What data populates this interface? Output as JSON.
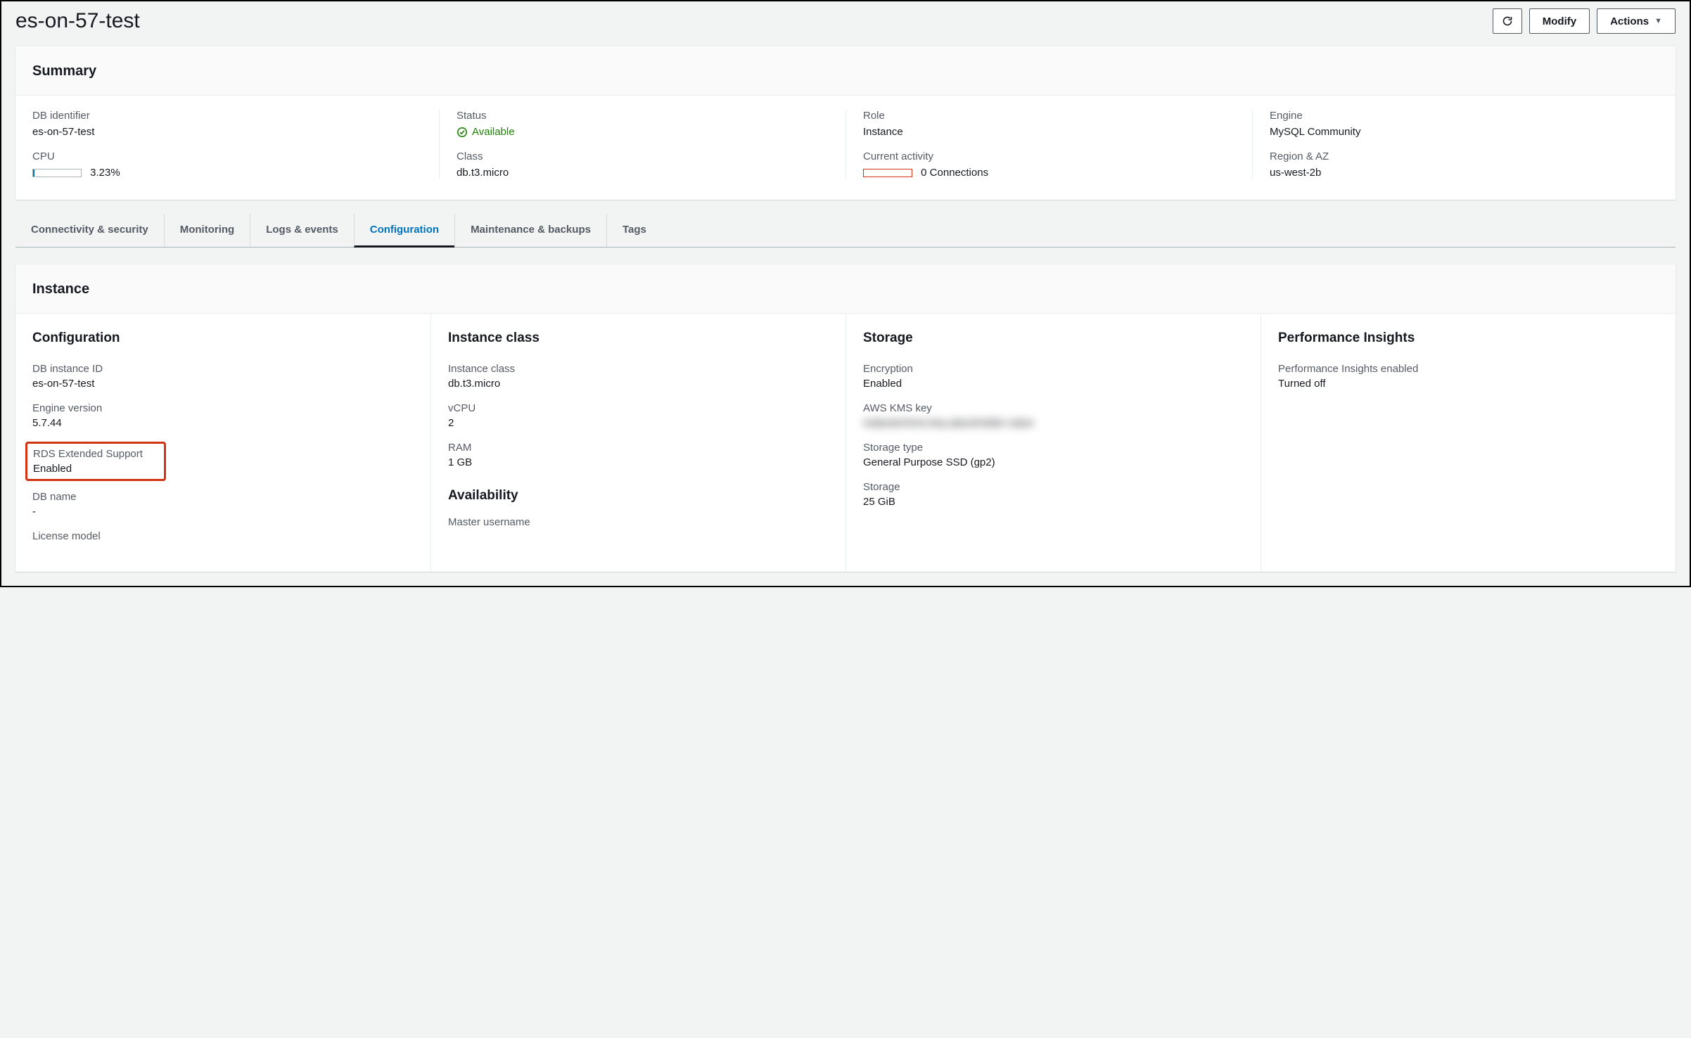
{
  "header": {
    "title": "es-on-57-test",
    "modify_label": "Modify",
    "actions_label": "Actions"
  },
  "summary": {
    "heading": "Summary",
    "col1": {
      "db_identifier_label": "DB identifier",
      "db_identifier_value": "es-on-57-test",
      "cpu_label": "CPU",
      "cpu_value": "3.23%",
      "cpu_fill_pct": 3.23
    },
    "col2": {
      "status_label": "Status",
      "status_value": "Available",
      "class_label": "Class",
      "class_value": "db.t3.micro"
    },
    "col3": {
      "role_label": "Role",
      "role_value": "Instance",
      "activity_label": "Current activity",
      "activity_value": "0 Connections",
      "activity_fill_pct": 0
    },
    "col4": {
      "engine_label": "Engine",
      "engine_value": "MySQL Community",
      "region_label": "Region & AZ",
      "region_value": "us-west-2b"
    }
  },
  "tabs": [
    {
      "label": "Connectivity & security",
      "active": false
    },
    {
      "label": "Monitoring",
      "active": false
    },
    {
      "label": "Logs & events",
      "active": false
    },
    {
      "label": "Configuration",
      "active": true
    },
    {
      "label": "Maintenance & backups",
      "active": false
    },
    {
      "label": "Tags",
      "active": false
    }
  ],
  "instance": {
    "heading": "Instance",
    "configuration": {
      "heading": "Configuration",
      "db_instance_id_label": "DB instance ID",
      "db_instance_id_value": "es-on-57-test",
      "engine_version_label": "Engine version",
      "engine_version_value": "5.7.44",
      "rds_ext_support_label": "RDS Extended Support",
      "rds_ext_support_value": "Enabled",
      "db_name_label": "DB name",
      "db_name_value": "-",
      "license_model_label": "License model"
    },
    "instance_class": {
      "heading": "Instance class",
      "class_label": "Instance class",
      "class_value": "db.t3.micro",
      "vcpu_label": "vCPU",
      "vcpu_value": "2",
      "ram_label": "RAM",
      "ram_value": "1 GB",
      "availability_heading": "Availability",
      "master_username_label": "Master username"
    },
    "storage": {
      "heading": "Storage",
      "encryption_label": "Encryption",
      "encryption_value": "Enabled",
      "kms_label": "AWS KMS key",
      "kms_value_obscured": "redacted-kms-key-placeholder-value",
      "storage_type_label": "Storage type",
      "storage_type_value": "General Purpose SSD (gp2)",
      "storage_label": "Storage",
      "storage_value": "25 GiB"
    },
    "performance": {
      "heading": "Performance Insights",
      "pi_label": "Performance Insights enabled",
      "pi_value": "Turned off"
    }
  }
}
